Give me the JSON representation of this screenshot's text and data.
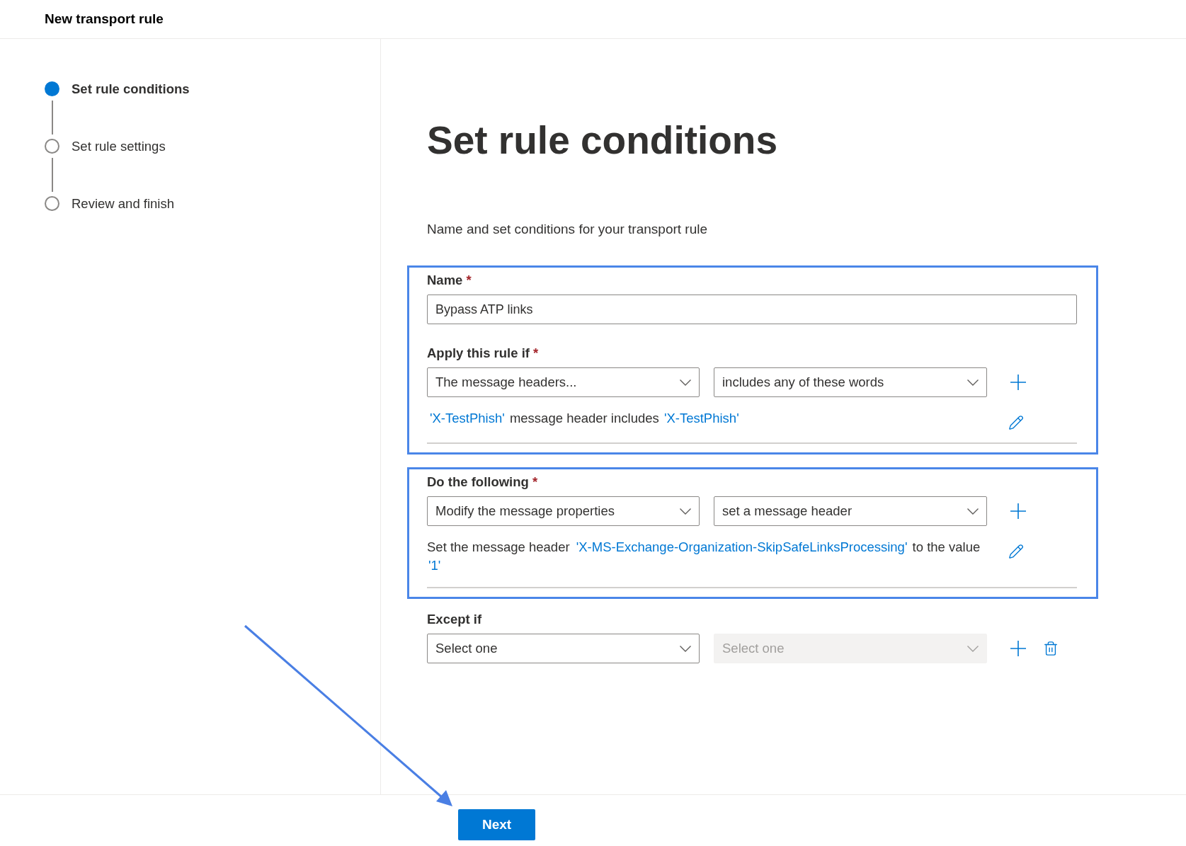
{
  "header": {
    "title": "New transport rule"
  },
  "steps": [
    {
      "label": "Set rule conditions",
      "selected": true
    },
    {
      "label": "Set rule settings",
      "selected": false
    },
    {
      "label": "Review and finish",
      "selected": false
    }
  ],
  "page": {
    "title": "Set rule conditions",
    "description": "Name and set conditions for your transport rule",
    "groups": [
      {
        "highlighted": true,
        "items": [
          {
            "kind": "text_field",
            "label": "Name",
            "required_mark": "*",
            "value": "Bypass ATP links"
          },
          {
            "kind": "rule",
            "label": "Apply this rule if",
            "required_mark": "*",
            "dropdowns": [
              {
                "value": "The message headers...",
                "disabled": false
              },
              {
                "value": "includes any of these words",
                "disabled": false
              }
            ],
            "add_button": true,
            "delete_button": false,
            "summary": [
              {
                "kind": "link",
                "text": "'X-TestPhish'"
              },
              {
                "kind": "text",
                "text": "message header includes"
              },
              {
                "kind": "link",
                "text": "'X-TestPhish'"
              }
            ]
          }
        ]
      },
      {
        "highlighted": true,
        "items": [
          {
            "kind": "rule",
            "label": "Do the following",
            "required_mark": "*",
            "dropdowns": [
              {
                "value": "Modify the message properties",
                "disabled": false
              },
              {
                "value": "set a message header",
                "disabled": false
              }
            ],
            "add_button": true,
            "delete_button": false,
            "summary": [
              {
                "kind": "text",
                "text": "Set the message header"
              },
              {
                "kind": "link",
                "text": "'X-MS-Exchange-Organization-SkipSafeLinksProcessing'"
              },
              {
                "kind": "text",
                "text": "to the value"
              },
              {
                "kind": "link",
                "text": "'1'"
              }
            ]
          }
        ]
      },
      {
        "highlighted": false,
        "items": [
          {
            "kind": "rule",
            "label": "Except if",
            "dropdowns": [
              {
                "placeholder": "Select one",
                "disabled": false
              },
              {
                "placeholder": "Select one",
                "disabled": true
              }
            ],
            "add_button": true,
            "delete_button": true
          }
        ]
      }
    ]
  },
  "footer": {
    "buttons": [
      {
        "label": "Next",
        "kind": "primary"
      }
    ]
  }
}
